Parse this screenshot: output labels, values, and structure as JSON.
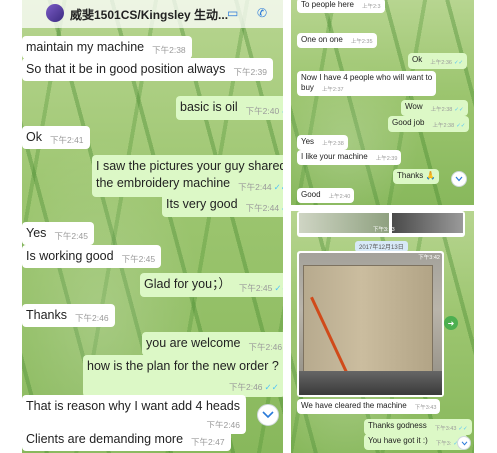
{
  "left_chat": {
    "header": {
      "title": "威斐1501CS/Kingsley 生动..."
    },
    "messages": [
      {
        "text": "maintain my machine",
        "time": "下午2:38",
        "dir": "in"
      },
      {
        "text": "So that it be in good position always",
        "time": "下午2:39",
        "dir": "in"
      },
      {
        "text": "basic is oil",
        "time": "下午2:40",
        "dir": "out",
        "ticks": "✓✓"
      },
      {
        "text": "Ok",
        "time": "下午2:41",
        "dir": "in"
      },
      {
        "text": "I saw the pictures your guy shared for",
        "text2": "the embroidery machine",
        "time": "下午2:44",
        "dir": "out",
        "ticks": "✓✓"
      },
      {
        "text": "Its very good",
        "time": "下午2:44",
        "dir": "out",
        "ticks": "✓✓"
      },
      {
        "text": "Yes",
        "time": "下午2:45",
        "dir": "in"
      },
      {
        "text": "Is working good",
        "time": "下午2:45",
        "dir": "in"
      },
      {
        "text": "Glad for you；）",
        "time": "下午2:45",
        "dir": "out",
        "ticks": "✓✓"
      },
      {
        "text": "Thanks",
        "time": "下午2:46",
        "dir": "in"
      },
      {
        "text": "you are welcome",
        "time": "下午2:46",
        "dir": "out",
        "ticks": "✓✓"
      },
      {
        "text": "how is the plan for the new order ?",
        "time": "下午2:46",
        "dir": "out",
        "ticks": "✓✓"
      },
      {
        "text": "That is reason why I want add 4 heads",
        "time": "下午2:46",
        "dir": "in"
      },
      {
        "text": "Clients are demanding more",
        "time": "下午2:47",
        "dir": "in"
      }
    ]
  },
  "right_top_chat": {
    "messages": [
      {
        "text": "To people here",
        "time": "上午2:3",
        "dir": "in"
      },
      {
        "text": "One on one",
        "time": "上午2:35",
        "dir": "in"
      },
      {
        "text": "Ok",
        "time": "上午2:36",
        "dir": "out",
        "ticks": "✓✓"
      },
      {
        "text": "Now I have 4 people who will want to",
        "text2": "buy",
        "time": "上午2:37",
        "dir": "in"
      },
      {
        "text": "Wow",
        "time": "上午2:38",
        "dir": "out",
        "ticks": "✓✓"
      },
      {
        "text": "Good job",
        "time": "上午2:38",
        "dir": "out",
        "ticks": "✓✓"
      },
      {
        "text": "Yes",
        "time": "上午2:38",
        "dir": "in"
      },
      {
        "text": "I like your machine",
        "time": "上午2:39",
        "dir": "in"
      },
      {
        "text": "Thanks 🙏",
        "time": "",
        "dir": "out"
      },
      {
        "text": "Good",
        "time": "上午2:40",
        "dir": "in"
      }
    ]
  },
  "right_bottom_chat": {
    "top_photo_time": "下午3:23",
    "date_chip": "2017年12月13日",
    "photo_time": "下午3:42",
    "messages": [
      {
        "text": "We have cleared the machine",
        "time": "下午3:43",
        "dir": "in"
      },
      {
        "text": "Thanks godness",
        "time": "下午3:43",
        "dir": "out",
        "ticks": "✓✓"
      },
      {
        "text": "You have got it :)",
        "time": "下午3:",
        "dir": "out",
        "ticks": "✓✓"
      }
    ]
  },
  "icons": {
    "scroll": "chevron-down-icon",
    "forward": "forward-icon",
    "avatar": "avatar"
  },
  "colors": {
    "incoming": "#ffffff",
    "outgoing": "#dcf8c6",
    "ticks": "#4fc3f7",
    "header": "#075e54"
  }
}
